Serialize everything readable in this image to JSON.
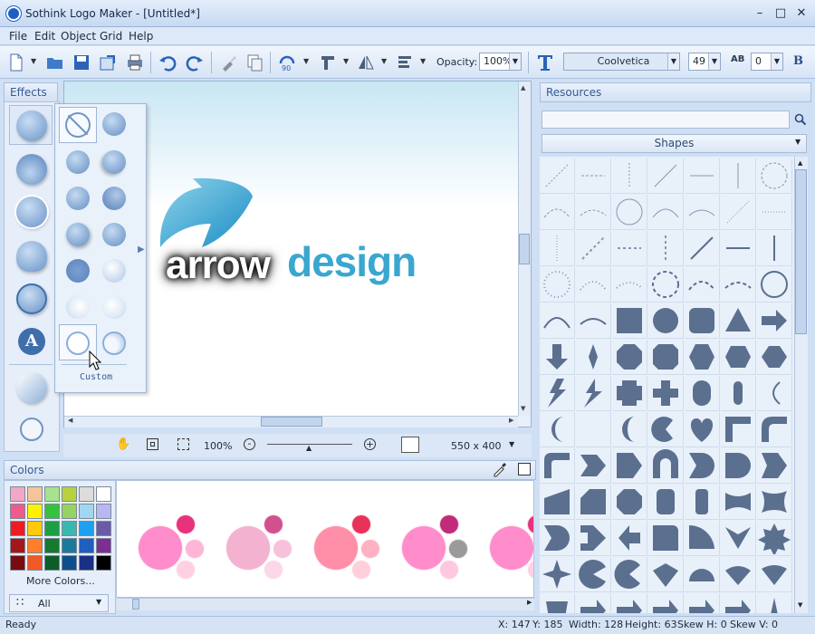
{
  "app": {
    "title": "Sothink Logo Maker - [Untitled*]"
  },
  "menu": [
    "File",
    "Edit",
    "Object",
    "Grid",
    "Help"
  ],
  "toolbar": {
    "opacity_label": "Opacity:",
    "opacity_value": "100%",
    "font": "Coolvetica",
    "font_size": "49",
    "spacing": "0",
    "bold": "B",
    "rotate_value": "90"
  },
  "effects": {
    "title": "Effects",
    "custom_label": "Custom"
  },
  "canvas": {
    "logo_word1": "arrow",
    "logo_word2": "design",
    "zoom": "100%",
    "size": "550 x 400"
  },
  "colors": {
    "title": "Colors",
    "more_colors": "More Colors...",
    "filter": "All",
    "swatches": [
      "#f4a6c6",
      "#f6c49a",
      "#a6e38c",
      "#b7d23d",
      "#dcdcdc",
      "#ffffff",
      "#f05a8a",
      "#fff200",
      "#35c23d",
      "#96d35f",
      "#9fd6f0",
      "#b7b7f2",
      "#ed1c24",
      "#ffc90e",
      "#1e9e45",
      "#3ab8b0",
      "#1ea0f0",
      "#6b5aa8",
      "#a4161a",
      "#ff7f27",
      "#147a2e",
      "#1b7a9b",
      "#1f5fbf",
      "#7d2f8f",
      "#7a0a10",
      "#f15a24",
      "#0d5d2a",
      "#0e4f8b",
      "#1a2f86",
      "#000000"
    ]
  },
  "resources": {
    "title": "Resources",
    "category": "Shapes"
  },
  "status": {
    "ready": "Ready",
    "x": "X: 147",
    "y": "Y: 185",
    "width": "Width: 128",
    "height": "Height: 63",
    "skew_h": "Skew H: 0",
    "skew_v": "Skew V: 0"
  },
  "icons": {
    "app": "app-logo-icon",
    "search": "search-icon",
    "eyedropper": "eyedropper-icon",
    "hand": "hand-icon",
    "cursor": "mouse-cursor-icon"
  }
}
